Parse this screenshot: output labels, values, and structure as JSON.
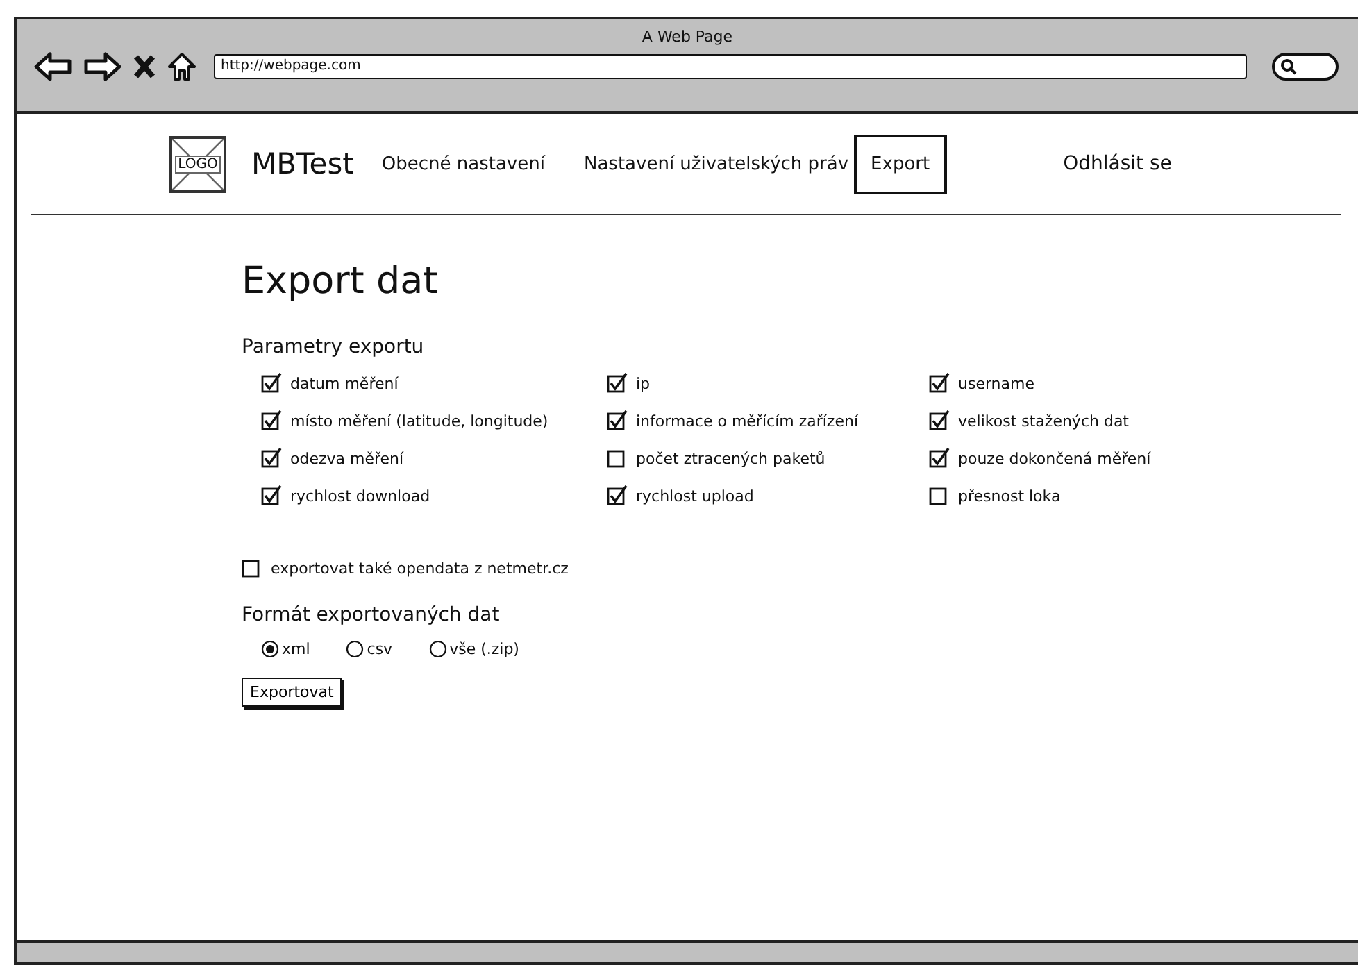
{
  "browser": {
    "title": "A Web Page",
    "url": "http://webpage.com"
  },
  "nav": {
    "logo": "LOGO",
    "brand": "MBTest",
    "items": [
      {
        "label": "Obecné nastavení",
        "selected": false
      },
      {
        "label": "Nastavení uživatelských práv",
        "selected": false
      },
      {
        "label": "Export",
        "selected": true
      }
    ],
    "logout": "Odhlásit se"
  },
  "heading": "Export dat",
  "params": {
    "title": "Parametry exportu",
    "options": [
      {
        "label": "datum měření",
        "checked": true
      },
      {
        "label": "ip",
        "checked": true
      },
      {
        "label": "username",
        "checked": true
      },
      {
        "label": "místo měření (latitude, longitude)",
        "checked": true
      },
      {
        "label": "informace o měřícím zařízení",
        "checked": true
      },
      {
        "label": "velikost stažených dat",
        "checked": true
      },
      {
        "label": "odezva měření",
        "checked": true
      },
      {
        "label": "počet ztracených paketů",
        "checked": false
      },
      {
        "label": "pouze dokončená měření",
        "checked": true
      },
      {
        "label": "rychlost download",
        "checked": true
      },
      {
        "label": "rychlost upload",
        "checked": true
      },
      {
        "label": "přesnost loka",
        "checked": false
      }
    ]
  },
  "opendata": {
    "label": "exportovat také opendata z netmetr.cz",
    "checked": false
  },
  "format": {
    "title": "Formát exportovaných dat",
    "options": [
      {
        "label": "xml",
        "selected": true
      },
      {
        "label": "csv",
        "selected": false
      },
      {
        "label": "vše (.zip)",
        "selected": false
      }
    ]
  },
  "export_button": "Exportovat"
}
